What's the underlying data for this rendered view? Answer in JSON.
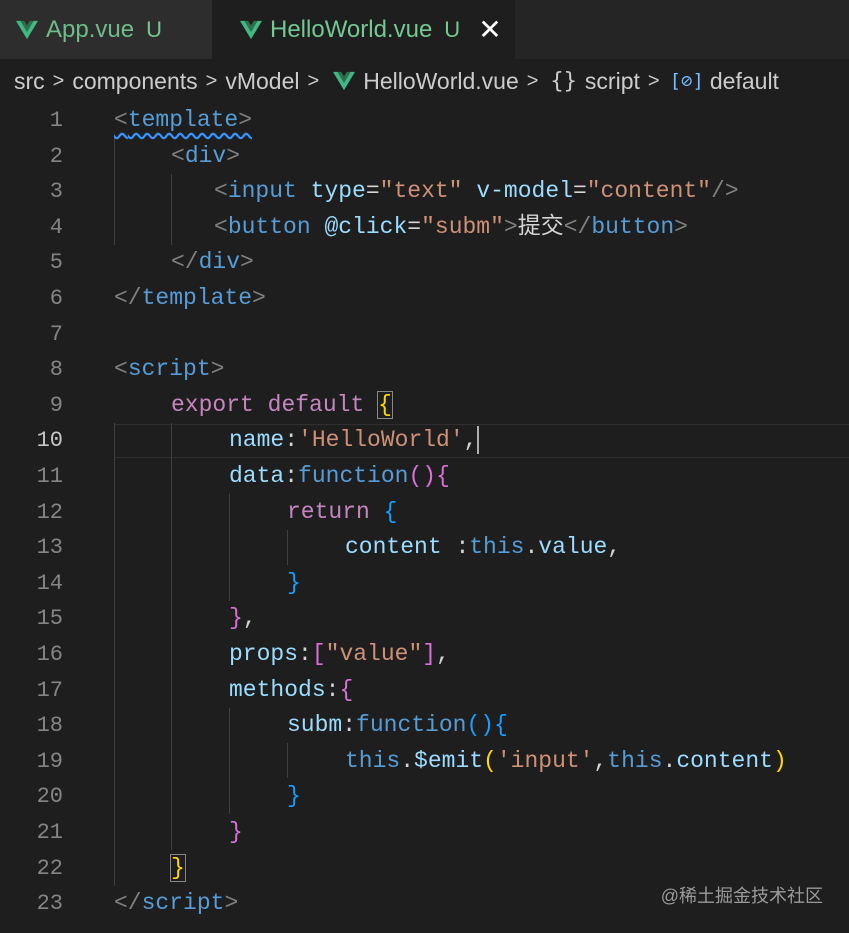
{
  "tabs": [
    {
      "label": "App.vue",
      "status": "U"
    },
    {
      "label": "HelloWorld.vue",
      "status": "U",
      "close": "✕"
    }
  ],
  "breadcrumb": {
    "folder1": "src",
    "folder2": "components",
    "folder3": "vModel",
    "file": "HelloWorld.vue",
    "braces": "{}",
    "section": "script",
    "symbol_icon": "[⊘]",
    "symbol": "default",
    "separator": ">"
  },
  "line_numbers": [
    "1",
    "2",
    "3",
    "4",
    "5",
    "6",
    "7",
    "8",
    "9",
    "10",
    "11",
    "12",
    "13",
    "14",
    "15",
    "16",
    "17",
    "18",
    "19",
    "20",
    "21",
    "22",
    "23"
  ],
  "current_line": "10",
  "code": {
    "l1_open": "<",
    "l1_tag": "template",
    "l1_close": ">",
    "l2_open": "<",
    "l2_tag": "div",
    "l2_close": ">",
    "l3_open": "<",
    "l3_tag": "input",
    "l3_attr1": "type",
    "l3_eq1": "=",
    "l3_val1": "\"text\"",
    "l3_attr2": "v-model",
    "l3_eq2": "=",
    "l3_val2": "\"content\"",
    "l3_close": "/>",
    "l4_open": "<",
    "l4_tag": "button",
    "l4_attr": "@click",
    "l4_eq": "=",
    "l4_val": "\"subm\"",
    "l4_gt": ">",
    "l4_text": "提交",
    "l4_end_open": "</",
    "l4_end_tag": "button",
    "l4_end_close": ">",
    "l5_open": "</",
    "l5_tag": "div",
    "l5_close": ">",
    "l6_open": "</",
    "l6_tag": "template",
    "l6_close": ">",
    "l8_open": "<",
    "l8_tag": "script",
    "l8_close": ">",
    "l9_kw1": "export",
    "l9_kw2": "default",
    "l9_brace": "{",
    "l10_key": "name",
    "l10_colon": ":",
    "l10_val": "'HelloWorld'",
    "l10_comma": ",",
    "l11_key": "data",
    "l11_colon": ":",
    "l11_fn": "function",
    "l11_paren": "()",
    "l11_brace": "{",
    "l12_kw": "return",
    "l12_brace": "{",
    "l13_key": "content",
    "l13_colon": ":",
    "l13_this": "this",
    "l13_dot": ".",
    "l13_prop": "value",
    "l13_comma": ",",
    "l14_brace": "}",
    "l15_brace": "}",
    "l15_comma": ",",
    "l16_key": "props",
    "l16_colon": ":",
    "l16_lb": "[",
    "l16_val": "\"value\"",
    "l16_rb": "]",
    "l16_comma": ",",
    "l17_key": "methods",
    "l17_colon": ":",
    "l17_brace": "{",
    "l18_key": "subm",
    "l18_colon": ":",
    "l18_fn": "function",
    "l18_paren": "()",
    "l18_brace": "{",
    "l19_this": "this",
    "l19_dot": ".",
    "l19_method": "$emit",
    "l19_lp": "(",
    "l19_str": "'input'",
    "l19_comma": ",",
    "l19_this2": "this",
    "l19_dot2": ".",
    "l19_prop": "content",
    "l19_rp": ")",
    "l20_brace": "}",
    "l21_brace": "}",
    "l22_brace": "}",
    "l23_open": "</",
    "l23_tag": "script",
    "l23_close": ">"
  },
  "watermark": "@稀土掘金技术社区"
}
